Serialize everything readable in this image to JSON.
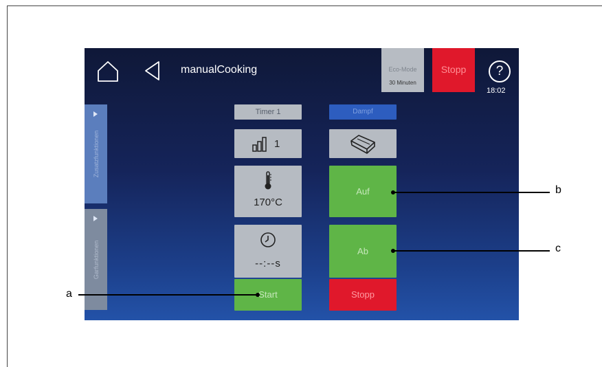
{
  "header": {
    "title": "manualCooking",
    "eco_mode_label": "Eco-Mode",
    "eco_mode_sub": "30 Minuten",
    "stopp_label": "Stopp",
    "help_symbol": "?",
    "time": "18:02"
  },
  "sidebar": {
    "tab1_label": "Zusatzfunktionen",
    "tab2_label": "Garfunktionen"
  },
  "left_column": {
    "timer_label": "Timer 1",
    "level_value": "1",
    "temperature": "170°C",
    "duration": "--:--s",
    "start_label": "Start"
  },
  "right_column": {
    "head_label": "Dampf",
    "auf_label": "Auf",
    "ab_label": "Ab",
    "stopp_label": "Stopp"
  },
  "callouts": {
    "a": "a",
    "b": "b",
    "c": "c"
  },
  "icons": [
    "home-icon",
    "back-arrow-icon",
    "help-icon",
    "bar-level-icon",
    "thermometer-icon",
    "clock-icon",
    "basket-icon"
  ],
  "colors": {
    "green": "#5fb547",
    "red": "#e0182b",
    "tile_gray": "#b6bbc2",
    "screen_dark": "#0f1838"
  }
}
